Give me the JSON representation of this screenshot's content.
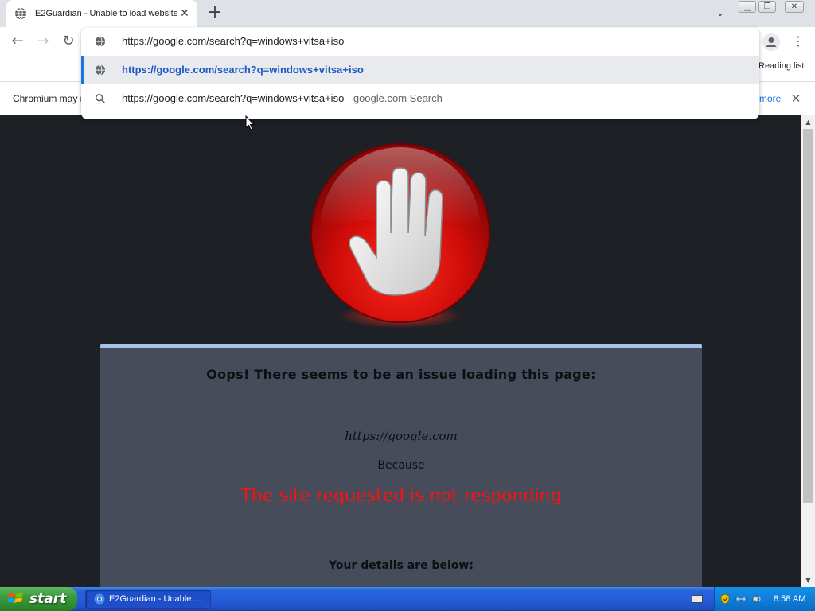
{
  "browser": {
    "tab": {
      "title": "E2Guardian - Unable to load website",
      "close_glyph": "✕"
    },
    "new_tab_glyph": "+",
    "tab_search_glyph": "⌄",
    "toolbar": {
      "back_glyph": "←",
      "forward_glyph": "→",
      "reload_glyph": "↻",
      "menu_glyph": "⋮"
    },
    "omnibox": {
      "input_value": "https://google.com/search?q=windows+vitsa+iso",
      "suggestions": [
        {
          "icon": "globe-icon",
          "text": "https://google.com/search?q=windows+vitsa+iso"
        },
        {
          "icon": "search-icon",
          "text": "https://google.com/search?q=windows+vitsa+iso",
          "suffix": " - google.com Search"
        }
      ]
    },
    "bookmarks_bar": {
      "reading_list": "Reading list"
    },
    "infobar": {
      "text": "Chromium may n",
      "link": "more",
      "close_glyph": "✕"
    }
  },
  "page": {
    "heading": "Oops! There seems to be an issue loading this page:",
    "blocked_url": "https://google.com",
    "because_label": "Because",
    "reason": "The site requested is not responding",
    "details_heading": "Your details are below:",
    "colors": {
      "background": "#1d2025",
      "card": "#464c59",
      "card_border": "#a3c4e8",
      "reason": "#ff1010"
    }
  },
  "scrollbar": {
    "up_glyph": "▲",
    "down_glyph": "▼"
  },
  "taskbar": {
    "start_label": "start",
    "task_label": "E2Guardian - Unable ...",
    "clock": "8:58 AM"
  }
}
